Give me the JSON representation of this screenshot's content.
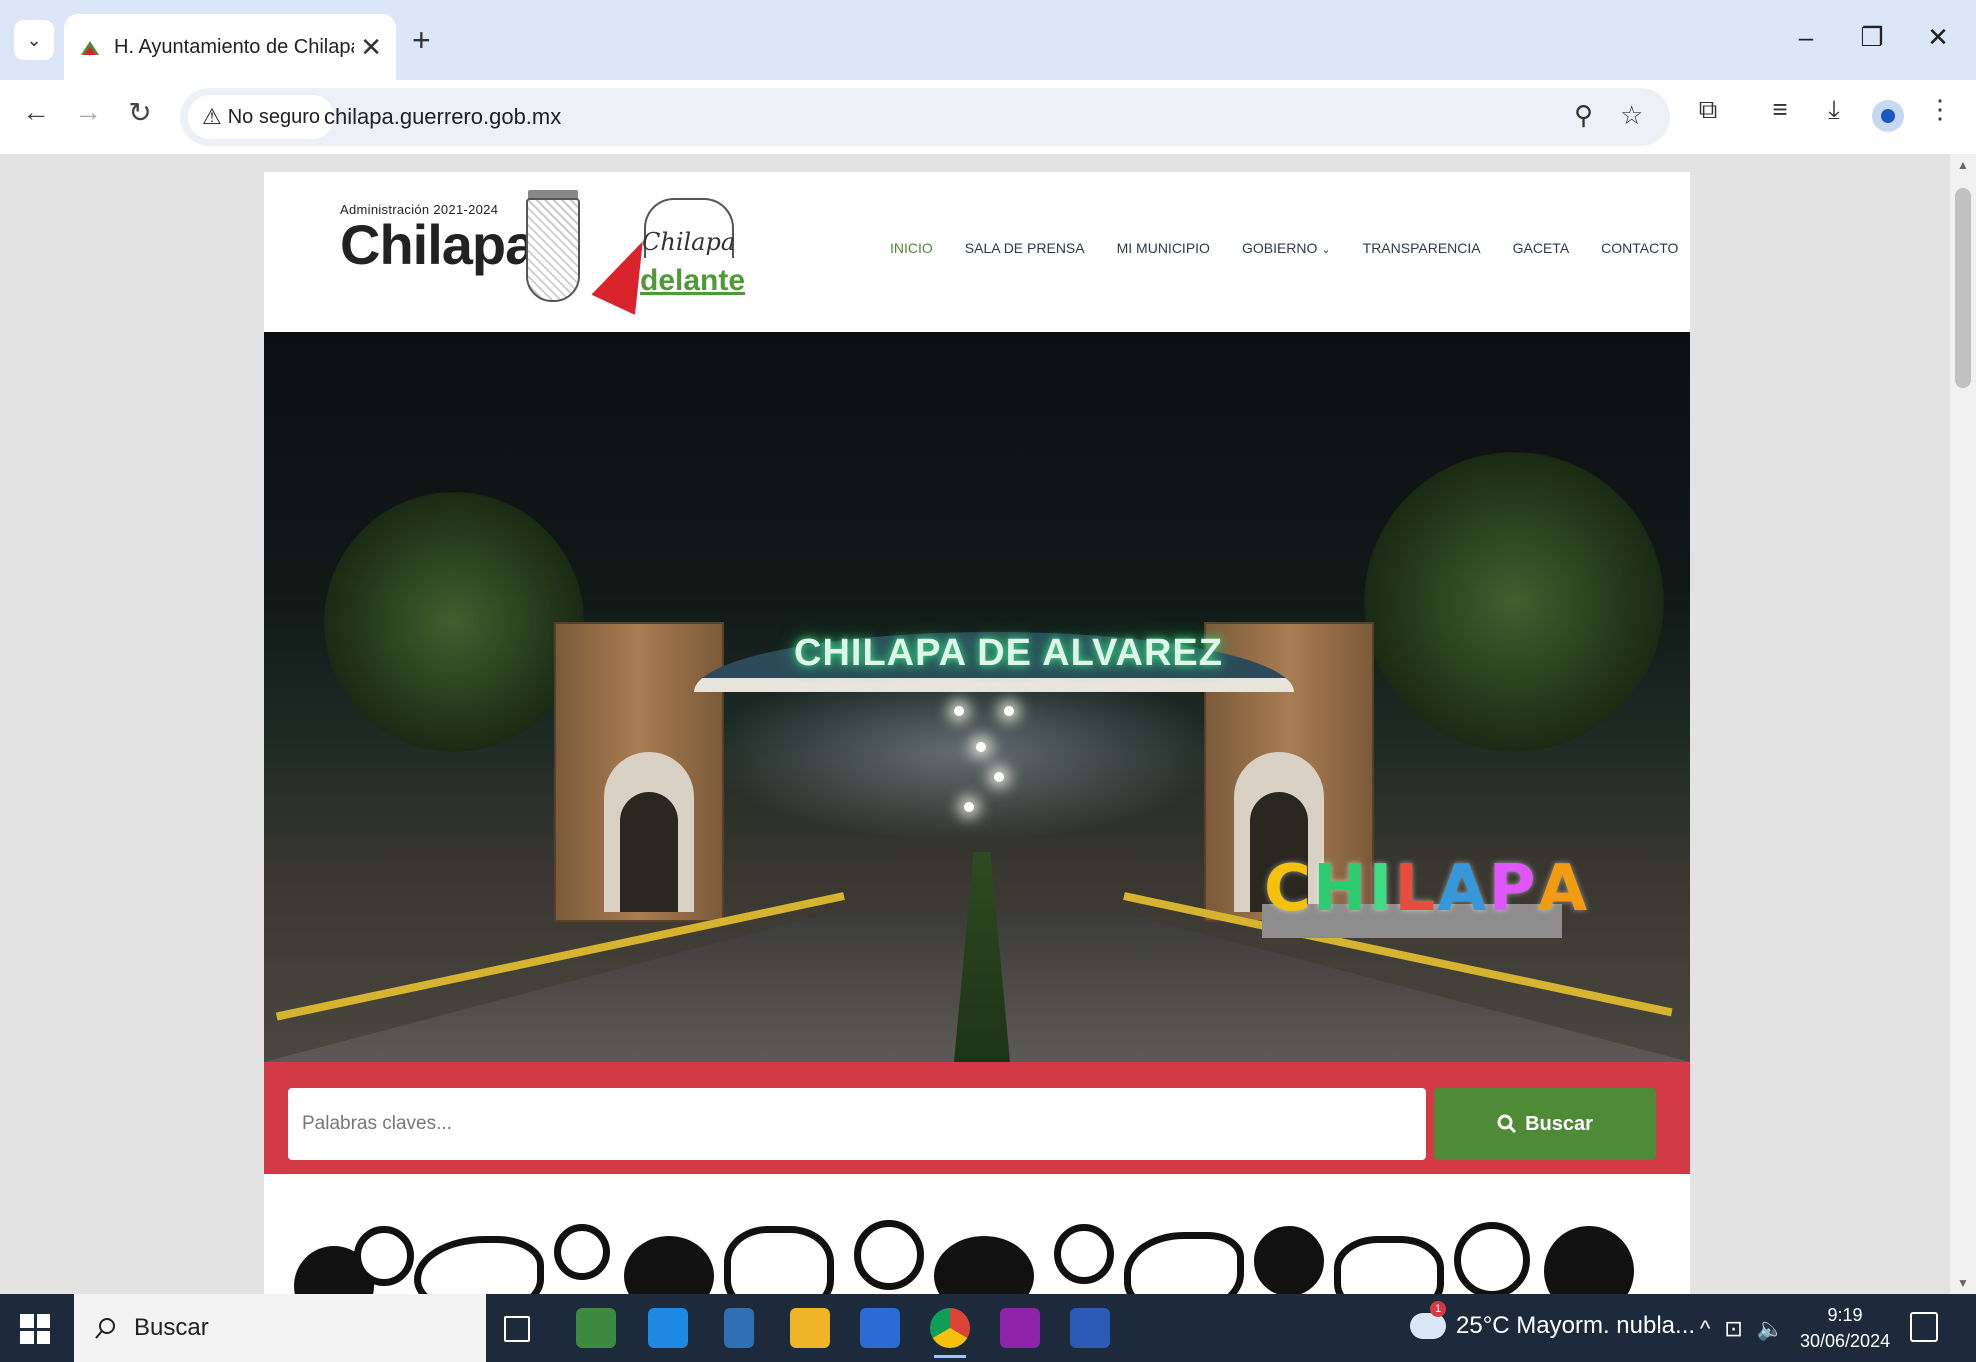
{
  "browser": {
    "tab_title": "H. Ayuntamiento de Chilapa de",
    "new_tab": "+",
    "security_label": "No seguro",
    "url": "chilapa.guerrero.gob.mx"
  },
  "site": {
    "logo_small": "Administración 2021-2024",
    "logo_big": "Chilapa",
    "slogan_script": "Chilapa",
    "slogan_word": "delante",
    "nav": [
      {
        "label": "INICIO"
      },
      {
        "label": "SALA DE PRENSA"
      },
      {
        "label": "MI MUNICIPIO"
      },
      {
        "label": "GOBIERNO"
      },
      {
        "label": "TRANSPARENCIA"
      },
      {
        "label": "GACETA"
      },
      {
        "label": "CONTACTO"
      }
    ],
    "hero_sign": "CHILAPA DE ALVAREZ",
    "hero_letters": "CHILAPA",
    "search": {
      "placeholder": "Palabras claves...",
      "button_label": "Buscar"
    },
    "back_to_top": "↑"
  },
  "taskbar": {
    "search_label": "Buscar",
    "weather": "25°C  Mayorm. nubla...",
    "weather_badge": "1",
    "time": "9:19",
    "date": "30/06/2024"
  },
  "colors": {
    "brand_green": "#4f8a36",
    "search_band_red": "#d43a46",
    "adelante_red": "#d8232a"
  }
}
